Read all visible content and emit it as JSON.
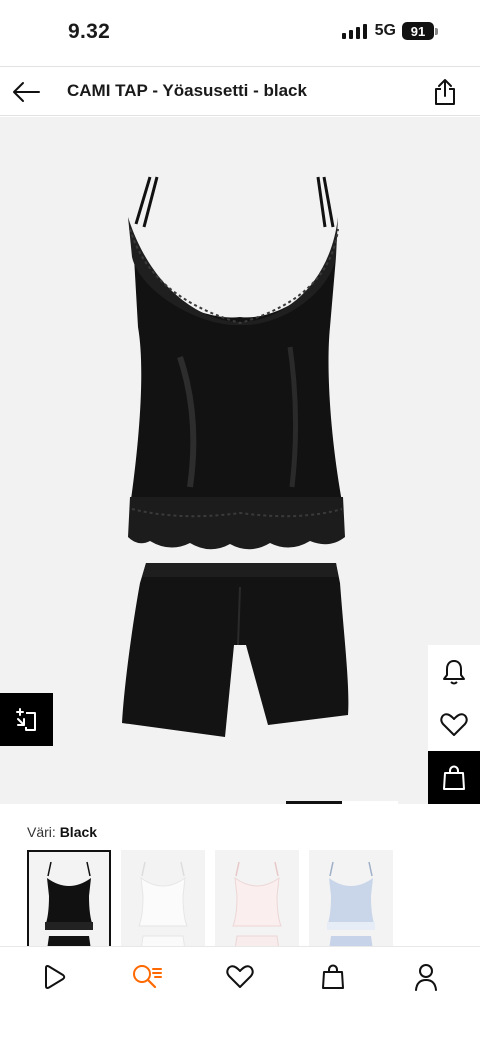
{
  "status_bar": {
    "time": "9.32",
    "network": "5G",
    "battery": "91"
  },
  "header": {
    "title": "CAMI TAP - Yöasusetti - black",
    "back_icon": "arrow-left-icon",
    "share_icon": "share-icon"
  },
  "gallery": {
    "image_alt": "Black satin camisole with lace trim and matching shorts",
    "current_page": 1,
    "total_pages": 2,
    "compare_icon": "compare-icon",
    "actions": [
      {
        "name": "bell-icon"
      },
      {
        "name": "heart-icon"
      },
      {
        "name": "bag-icon"
      }
    ]
  },
  "color": {
    "label": "Väri:",
    "value": "Black",
    "swatches": [
      {
        "name": "Black",
        "selected": true
      },
      {
        "name": "White",
        "selected": false
      },
      {
        "name": "Pink",
        "selected": false
      },
      {
        "name": "Light blue",
        "selected": false
      }
    ]
  },
  "bottom_nav": {
    "items": [
      {
        "icon": "play-icon"
      },
      {
        "icon": "search-icon",
        "active": true
      },
      {
        "icon": "heart-icon"
      },
      {
        "icon": "bag-icon"
      },
      {
        "icon": "user-icon"
      }
    ]
  },
  "colors": {
    "accent": "#ff6900",
    "image_bg": "#f2f2f2",
    "dark": "#000000"
  }
}
